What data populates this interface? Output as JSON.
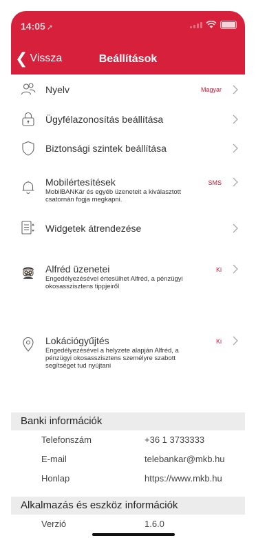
{
  "status_bar": {
    "time": "14:05"
  },
  "nav": {
    "back_label": "Vissza",
    "title": "Beállítások"
  },
  "settings": [
    {
      "label": "Nyelv",
      "value": "Magyar",
      "icon": "people-icon"
    },
    {
      "label": "Ügyfélazonosítás beállítása",
      "icon": "lock-icon"
    },
    {
      "label": "Biztonsági szintek beállítása",
      "icon": "shield-icon"
    },
    {
      "label": "Mobilértesítések",
      "sub": "MobilBANKár és egyéb üzeneteit a kiválasztott csatornán fogja megkapni.",
      "value": "SMS",
      "icon": "bell-icon"
    },
    {
      "label": "Widgetek átrendezése",
      "icon": "widget-icon"
    },
    {
      "label": "Alfréd üzenetei",
      "sub": "Engedélyezésével értesülhet Alfréd, a pénzügyi okosasszisztens tippjeiről",
      "value": "Ki",
      "icon": "alfred-icon"
    },
    {
      "label": "Lokációgyűjtés",
      "sub": "Engedélyezésével a helyzete alapján Alfréd, a pénzügyi okosasszisztens személyre szabott segítséget tud nyújtani",
      "value": "Ki",
      "icon": "location-pin-icon"
    }
  ],
  "bank_info": {
    "title": "Banki információk",
    "rows": [
      {
        "key": "Telefonszám",
        "value": "+36 1 3733333"
      },
      {
        "key": "E-mail",
        "value": "telebankar@mkb.hu"
      },
      {
        "key": "Honlap",
        "value": "https://www.mkb.hu"
      }
    ]
  },
  "app_info": {
    "title": "Alkalmazás és eszköz információk",
    "rows": [
      {
        "key": "Verzió",
        "value": "1.6.0"
      }
    ]
  },
  "colors": {
    "brand": "#d6203c",
    "value_red": "#c51a35",
    "section_bg": "#ececec"
  }
}
